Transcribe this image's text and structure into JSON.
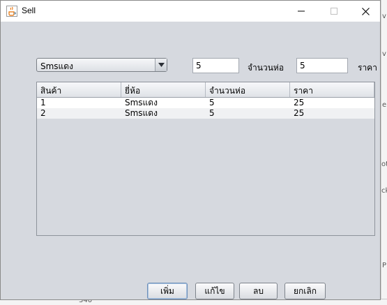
{
  "window": {
    "title": "Sell",
    "icon": "java-cup-icon",
    "controls": [
      "minimize-icon",
      "maximize-icon",
      "close-icon"
    ]
  },
  "form": {
    "product_select": {
      "selected": "Smsแดง"
    },
    "quantity": {
      "label": "จำนวนห่อ",
      "value": "5"
    },
    "price": {
      "label": "ราคา",
      "value": "5"
    }
  },
  "table": {
    "columns": [
      "สินค้า",
      "ยี่ห้อ",
      "จำนวนห่อ",
      "ราคา"
    ],
    "rows": [
      [
        "1",
        "Smsแดง",
        "5",
        "25"
      ],
      [
        "2",
        "Smsแดง",
        "5",
        "25"
      ]
    ]
  },
  "buttons": {
    "add": "เพิ่ม",
    "edit": "แก้ไข",
    "delete": "ลบ",
    "cancel": "ยกเลิก"
  },
  "background": {
    "marks": [
      "v",
      "v",
      "e",
      "ot",
      "ck",
      "P",
      "340"
    ]
  },
  "colors": {
    "window_bg": "#d6d9df",
    "titlebar_bg": "#ffffff",
    "row_alt": "#f0f1f3"
  }
}
